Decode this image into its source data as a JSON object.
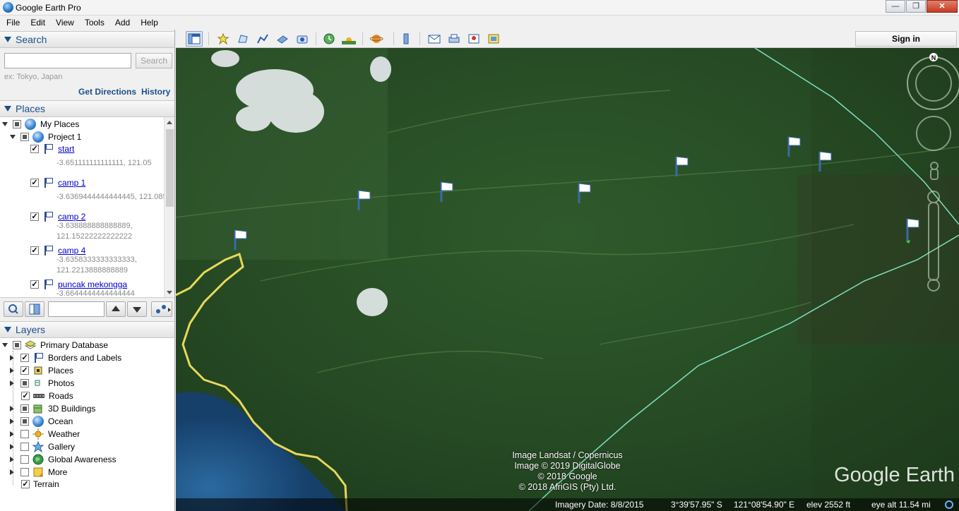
{
  "app": {
    "title": "Google Earth Pro"
  },
  "window_controls": {
    "minimize": "—",
    "maximize": "❐",
    "close": "✕"
  },
  "menu": [
    "File",
    "Edit",
    "View",
    "Tools",
    "Add",
    "Help"
  ],
  "search": {
    "header": "Search",
    "placeholder": "",
    "button": "Search",
    "hint": "ex: Tokyo, Japan",
    "get_directions": "Get Directions",
    "history": "History"
  },
  "places": {
    "header": "Places",
    "my_places": "My Places",
    "project": "Project 1",
    "items": [
      {
        "name": "start",
        "coords1": "-3.651111111111111, 121.05",
        "coords2": ""
      },
      {
        "name": "camp 1",
        "coords1": "-3.6369444444444445, 121.085",
        "coords2": ""
      },
      {
        "name": "camp 2",
        "coords1": "-3.638888888888889,",
        "coords2": "121.15222222222222"
      },
      {
        "name": "camp 4",
        "coords1": "-3.6358333333333333,",
        "coords2": "121.2213888888889"
      },
      {
        "name": "puncak mekongga",
        "coords1": "-3.6644444444444444",
        "coords2": ""
      }
    ]
  },
  "layers": {
    "header": "Layers",
    "items": [
      {
        "label": "Primary Database",
        "icon": "database-icon",
        "state": "partial",
        "expand": "open"
      },
      {
        "label": "Borders and Labels",
        "icon": "flag-icon",
        "state": "checked",
        "expand": "closed"
      },
      {
        "label": "Places",
        "icon": "places-icon",
        "state": "checked",
        "expand": "closed"
      },
      {
        "label": "Photos",
        "icon": "photo-icon",
        "state": "partial",
        "expand": "closed"
      },
      {
        "label": "Roads",
        "icon": "roads-icon",
        "state": "checked",
        "expand": "none"
      },
      {
        "label": "3D Buildings",
        "icon": "building-icon",
        "state": "partial",
        "expand": "closed"
      },
      {
        "label": "Ocean",
        "icon": "ocean-icon",
        "state": "partial",
        "expand": "closed"
      },
      {
        "label": "Weather",
        "icon": "weather-icon",
        "state": "unchecked",
        "expand": "closed"
      },
      {
        "label": "Gallery",
        "icon": "gallery-icon",
        "state": "unchecked",
        "expand": "closed"
      },
      {
        "label": "Global Awareness",
        "icon": "globe-icon",
        "state": "unchecked",
        "expand": "closed"
      },
      {
        "label": "More",
        "icon": "folder-icon",
        "state": "unchecked",
        "expand": "closed"
      },
      {
        "label": "Terrain",
        "icon": "",
        "state": "checked",
        "expand": "none"
      }
    ]
  },
  "toolbar": {
    "sign_in": "Sign in"
  },
  "map": {
    "attribution": [
      "Image Landsat / Copernicus",
      "Image © 2019 DigitalGlobe",
      "© 2018 Google",
      "© 2018 AfriGIS (Pty) Ltd."
    ],
    "watermark": "Google Earth",
    "compass_north": "N",
    "status": {
      "imagery_date": "Imagery Date: 8/8/2015",
      "lat": "3°39'57.95\" S",
      "lon": "121°08'54.90\" E",
      "elev": "elev  2552 ft",
      "eye_alt": "eye alt  11.54 mi"
    }
  },
  "colors": {
    "accent": "#1b4f8a",
    "link": "#0000cc",
    "border_line": "#e8d85a",
    "boundary_line": "#7fe0c0"
  }
}
